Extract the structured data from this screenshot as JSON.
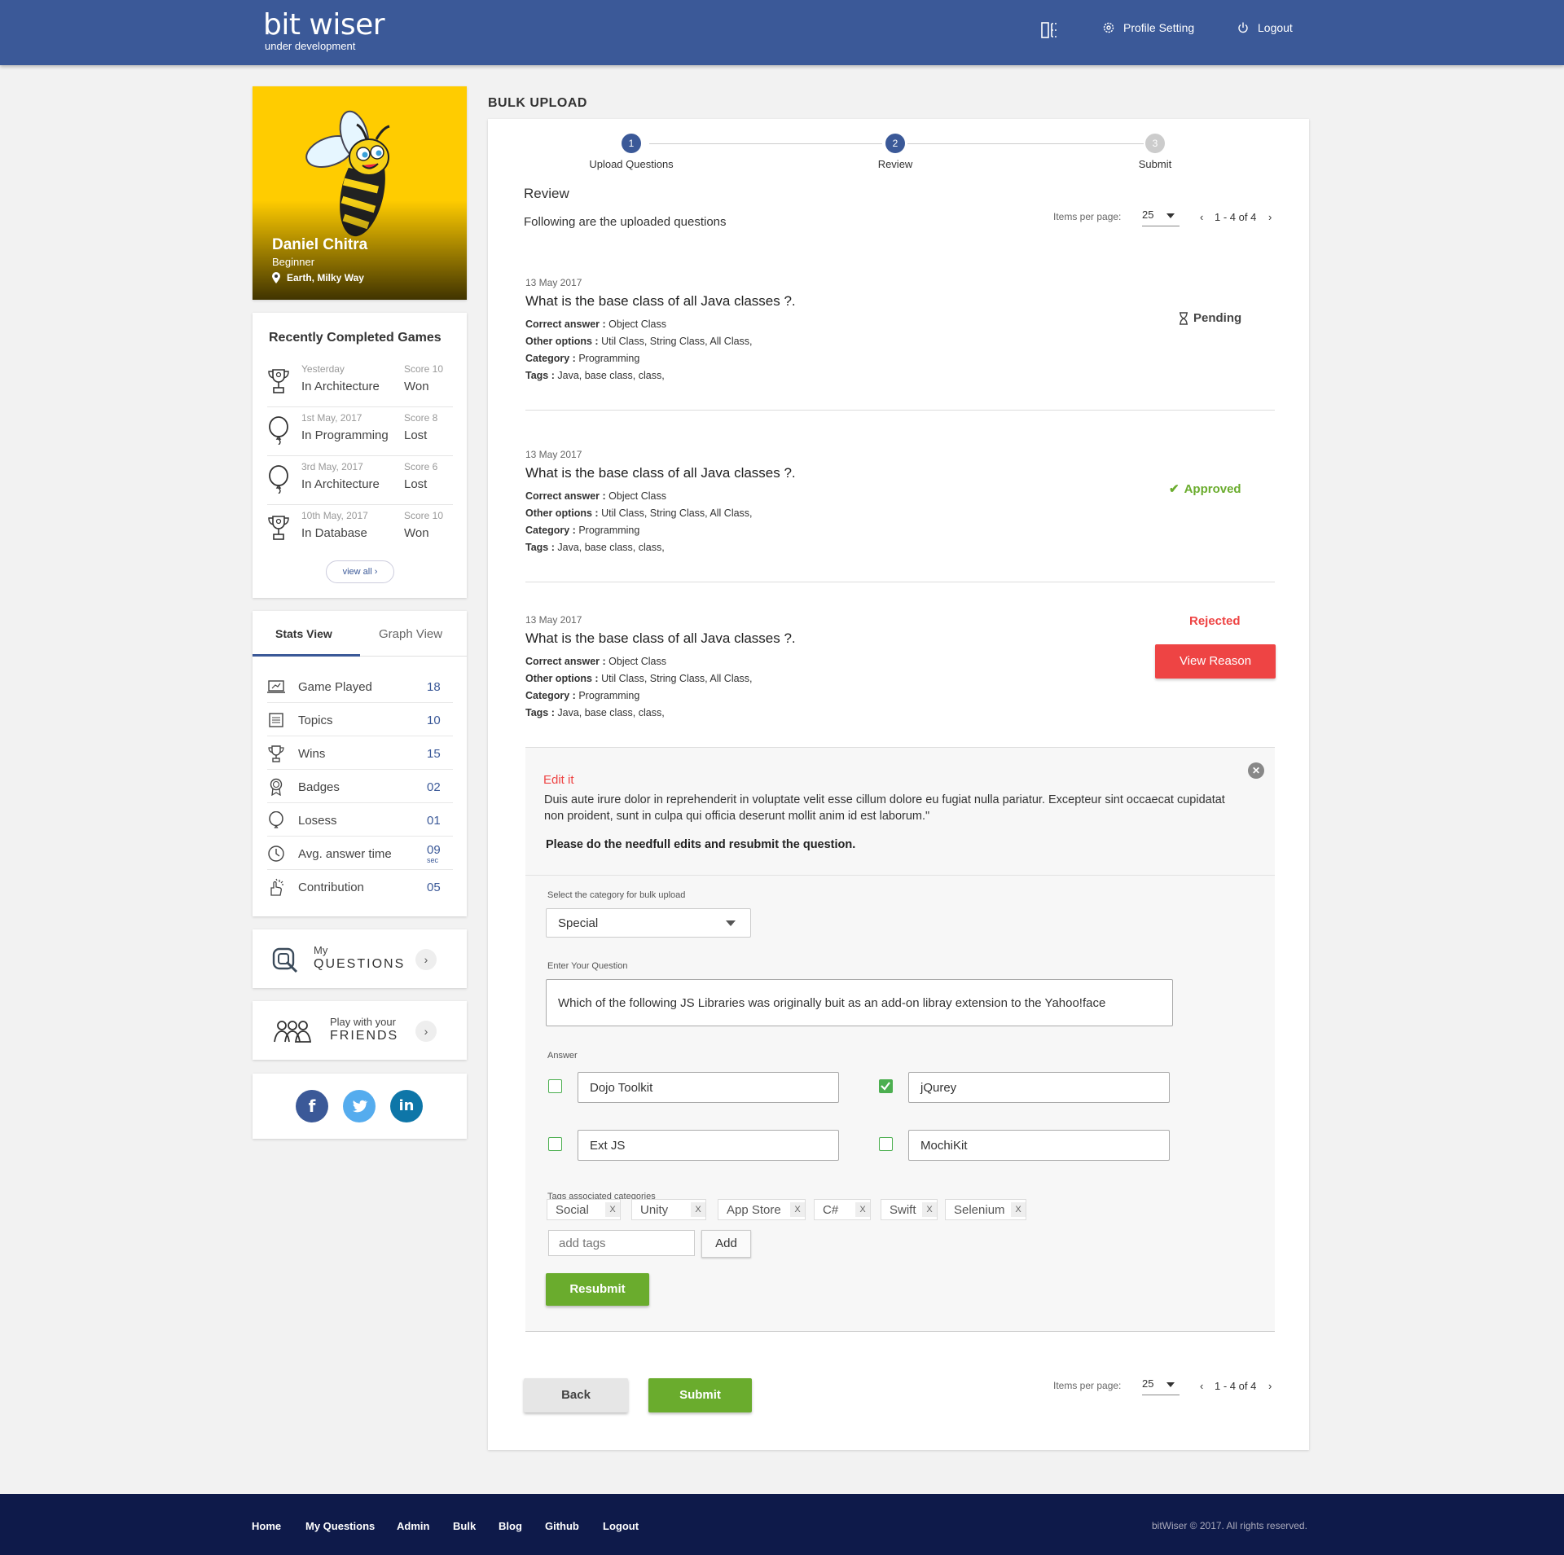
{
  "header": {
    "brand": "bit wiser",
    "brand_sub": "under development",
    "profile_setting": "Profile Setting",
    "logout": "Logout"
  },
  "profile": {
    "name": "Daniel Chitra",
    "level": "Beginner",
    "location": "Earth, Milky Way"
  },
  "recent_games": {
    "title": "Recently Completed Games",
    "items": [
      {
        "date": "Yesterday",
        "category": "In Architecture",
        "score": "Score 10",
        "result": "Won",
        "icon": "trophy-icon"
      },
      {
        "date": "1st May, 2017",
        "category": "In Programming",
        "score": "Score 8",
        "result": "Lost",
        "icon": "balloon-icon"
      },
      {
        "date": "3rd May, 2017",
        "category": "In Architecture",
        "score": "Score 6",
        "result": "Lost",
        "icon": "balloon-icon"
      },
      {
        "date": "10th May, 2017",
        "category": "In Database",
        "score": "Score 10",
        "result": "Won",
        "icon": "trophy-icon"
      }
    ],
    "view_all": "view all"
  },
  "stats": {
    "tabs": [
      "Stats View",
      "Graph View"
    ],
    "rows": [
      {
        "label": "Game Played",
        "value": "18",
        "icon": "laptop-icon"
      },
      {
        "label": "Topics",
        "value": "10",
        "icon": "list-icon"
      },
      {
        "label": "Wins",
        "value": "15",
        "icon": "trophy-icon"
      },
      {
        "label": "Badges",
        "value": "02",
        "icon": "badge-icon"
      },
      {
        "label": "Losess",
        "value": "01",
        "icon": "balloon-icon"
      },
      {
        "label": "Avg. answer time",
        "value": "09",
        "unit": "sec",
        "icon": "clock-icon"
      },
      {
        "label": "Contribution",
        "value": "05",
        "icon": "hand-icon"
      }
    ]
  },
  "my_questions": {
    "small": "My",
    "big": "QUESTIONS"
  },
  "friends": {
    "small": "Play with your",
    "big": "FRIENDS"
  },
  "page_title": "BULK UPLOAD",
  "steps": [
    {
      "num": "1",
      "label": "Upload Questions"
    },
    {
      "num": "2",
      "label": "Review"
    },
    {
      "num": "3",
      "label": "Submit"
    }
  ],
  "review": {
    "title": "Review",
    "subtitle": "Following are the uploaded questions",
    "items_per_page_label": "Items per page:",
    "items_per_page": "25",
    "range": "1 - 4 of 4"
  },
  "questions": [
    {
      "date": "13 May 2017",
      "title": "What is the base class of all Java classes ?.",
      "correct_label": "Correct answer :",
      "correct": "Object Class",
      "other_label": "Other options :",
      "other": "Util Class, String Class, All Class,",
      "category_label": "Category :",
      "category": "Programming",
      "tags_label": "Tags :",
      "tags": "Java, base class, class,",
      "status": "Pending"
    },
    {
      "date": "13 May 2017",
      "title": "What is the base class of all Java classes ?.",
      "correct_label": "Correct answer :",
      "correct": "Object Class",
      "other_label": "Other options :",
      "other": "Util Class, String Class, All Class,",
      "category_label": "Category :",
      "category": "Programming",
      "tags_label": "Tags :",
      "tags": "Java, base class, class,",
      "status": "Approved"
    },
    {
      "date": "13 May 2017",
      "title": "What is the base class of all Java classes ?.",
      "correct_label": "Correct answer :",
      "correct": "Object Class",
      "other_label": "Other options :",
      "other": "Util Class, String Class, All Class,",
      "category_label": "Category :",
      "category": "Programming",
      "tags_label": "Tags :",
      "tags": "Java, base class, class,",
      "status": "Rejected",
      "action": "View Reason"
    }
  ],
  "edit": {
    "heading": "Edit it",
    "reason": "Duis aute irure dolor in reprehenderit in voluptate velit esse cillum dolore eu fugiat nulla pariatur. Excepteur sint occaecat cupidatat non proident, sunt in culpa qui officia deserunt mollit anim id est laborum.\"",
    "instruction": "Please do the needfull edits and resubmit the question.",
    "category_label": "Select the category for bulk upload",
    "category_value": "Special",
    "question_label": "Enter Your Question",
    "question_value": "Which of the following JS Libraries was originally buit as an add-on libray extension to the Yahoo!face",
    "answer_label": "Answer",
    "answers": [
      {
        "text": "Dojo Toolkit",
        "checked": false
      },
      {
        "text": "jQurey",
        "checked": true
      },
      {
        "text": "Ext JS",
        "checked": false
      },
      {
        "text": "MochiKit",
        "checked": false
      }
    ],
    "tags_label": "Tags associated categories",
    "tags": [
      "Social",
      "Unity",
      "App Store",
      "C#",
      "Swift",
      "Selenium"
    ],
    "tag_remove": "X",
    "add_tags_placeholder": "add tags",
    "add_button": "Add",
    "resubmit": "Resubmit"
  },
  "actions": {
    "back": "Back",
    "submit": "Submit"
  },
  "footer": {
    "links": [
      "Home",
      "My Questions",
      "Admin",
      "Bulk",
      "Blog",
      "Github",
      "Logout"
    ],
    "copyright": "bitWiser © 2017. All rights reserved."
  },
  "colors": {
    "brand": "#3b5998",
    "green": "#6aac2d",
    "red": "#ee4444",
    "yellow": "#ffcc00",
    "footer": "#0e1a4a"
  }
}
